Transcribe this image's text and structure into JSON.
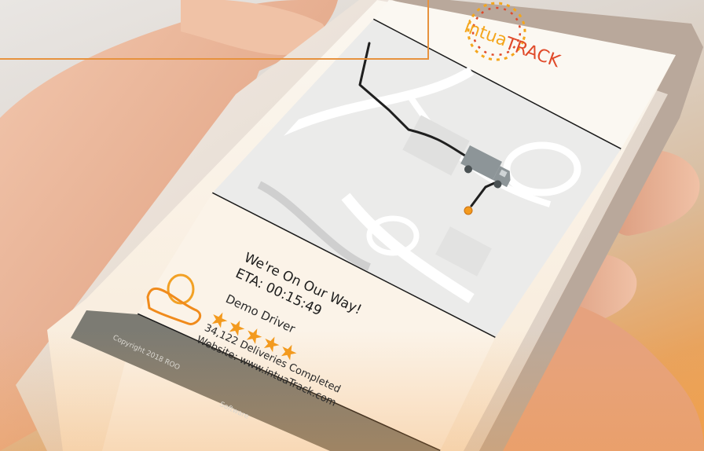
{
  "brand": {
    "name_part1": "intua",
    "name_part2": "TRACK"
  },
  "tracking": {
    "status": "We're On Our Way!",
    "eta": "ETA: 00:15:49"
  },
  "driver": {
    "name": "Demo Driver",
    "rating": 5,
    "deliveries": "34,122 Deliveries Completed",
    "website": "Website: www.intuaTrack.com"
  },
  "footer": {
    "copyright_start": "Copyright 2018 ROO",
    "copyright_end": "Software"
  },
  "colors": {
    "brand_orange": "#f4a61c",
    "brand_red": "#e04a2a",
    "star": "#f39a1e",
    "route": "#1f1f1f",
    "truck": "#8d9598",
    "frame_accent": "#e7923e"
  },
  "icons": [
    "sun-ring-logo-icon",
    "truck-icon",
    "destination-dot-icon",
    "driver-avatar-icon",
    "star-icon"
  ]
}
